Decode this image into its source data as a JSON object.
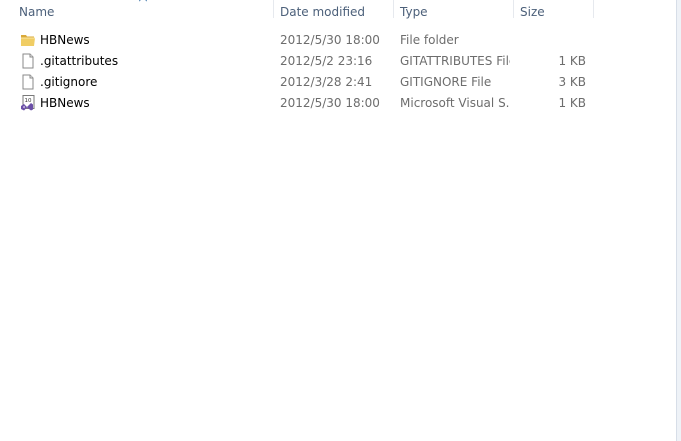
{
  "columns": {
    "name": "Name",
    "date_modified": "Date modified",
    "type": "Type",
    "size": "Size"
  },
  "files": [
    {
      "name": "HBNews",
      "date": "2012/5/30 18:00",
      "type": "File folder",
      "size": "",
      "icon": "folder-icon"
    },
    {
      "name": ".gitattributes",
      "date": "2012/5/2 23:16",
      "type": "GITATTRIBUTES File",
      "size": "1 KB",
      "icon": "file-icon"
    },
    {
      "name": ".gitignore",
      "date": "2012/3/28 2:41",
      "type": "GITIGNORE File",
      "size": "3 KB",
      "icon": "file-icon"
    },
    {
      "name": "HBNews",
      "date": "2012/5/30 18:00",
      "type": "Microsoft Visual S...",
      "size": "1 KB",
      "icon": "visual-studio-solution-icon"
    }
  ],
  "colors": {
    "header_text": "#4c607a",
    "detail_text": "#6d6d6d",
    "folder": "#e9c35a"
  }
}
